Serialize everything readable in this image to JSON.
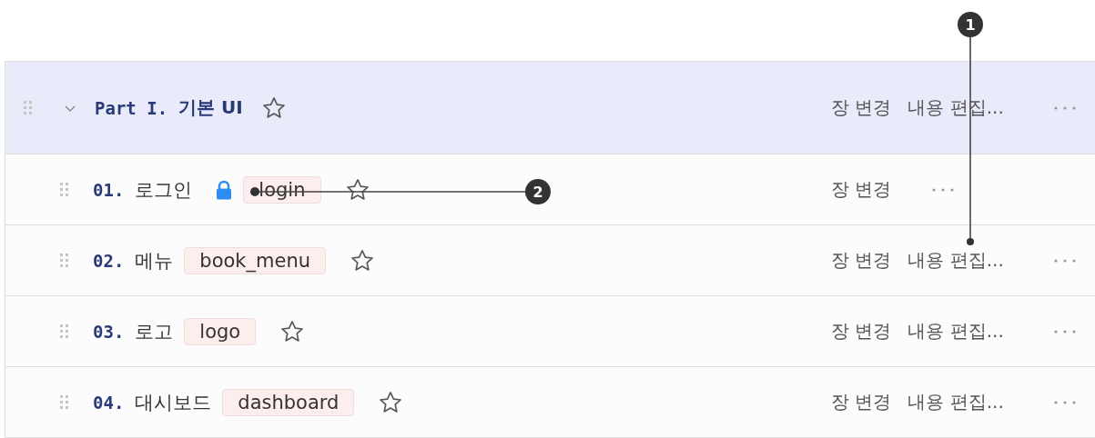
{
  "part": {
    "number": "Part I.",
    "title": "기본 UI",
    "expanded": true,
    "actions": [
      "장 변경",
      "내용 편집..."
    ]
  },
  "chapters": [
    {
      "number": "01.",
      "title": "로그인",
      "locked": true,
      "tag": "login",
      "actions": [
        "장 변경"
      ]
    },
    {
      "number": "02.",
      "title": "메뉴",
      "locked": false,
      "tag": "book_menu",
      "actions": [
        "장 변경",
        "내용 편집..."
      ]
    },
    {
      "number": "03.",
      "title": "로고",
      "locked": false,
      "tag": "logo",
      "actions": [
        "장 변경",
        "내용 편집..."
      ]
    },
    {
      "number": "04.",
      "title": "대시보드",
      "locked": false,
      "tag": "dashboard",
      "actions": [
        "장 변경",
        "내용 편집..."
      ]
    }
  ],
  "callouts": [
    {
      "label": "1"
    },
    {
      "label": "2"
    }
  ]
}
